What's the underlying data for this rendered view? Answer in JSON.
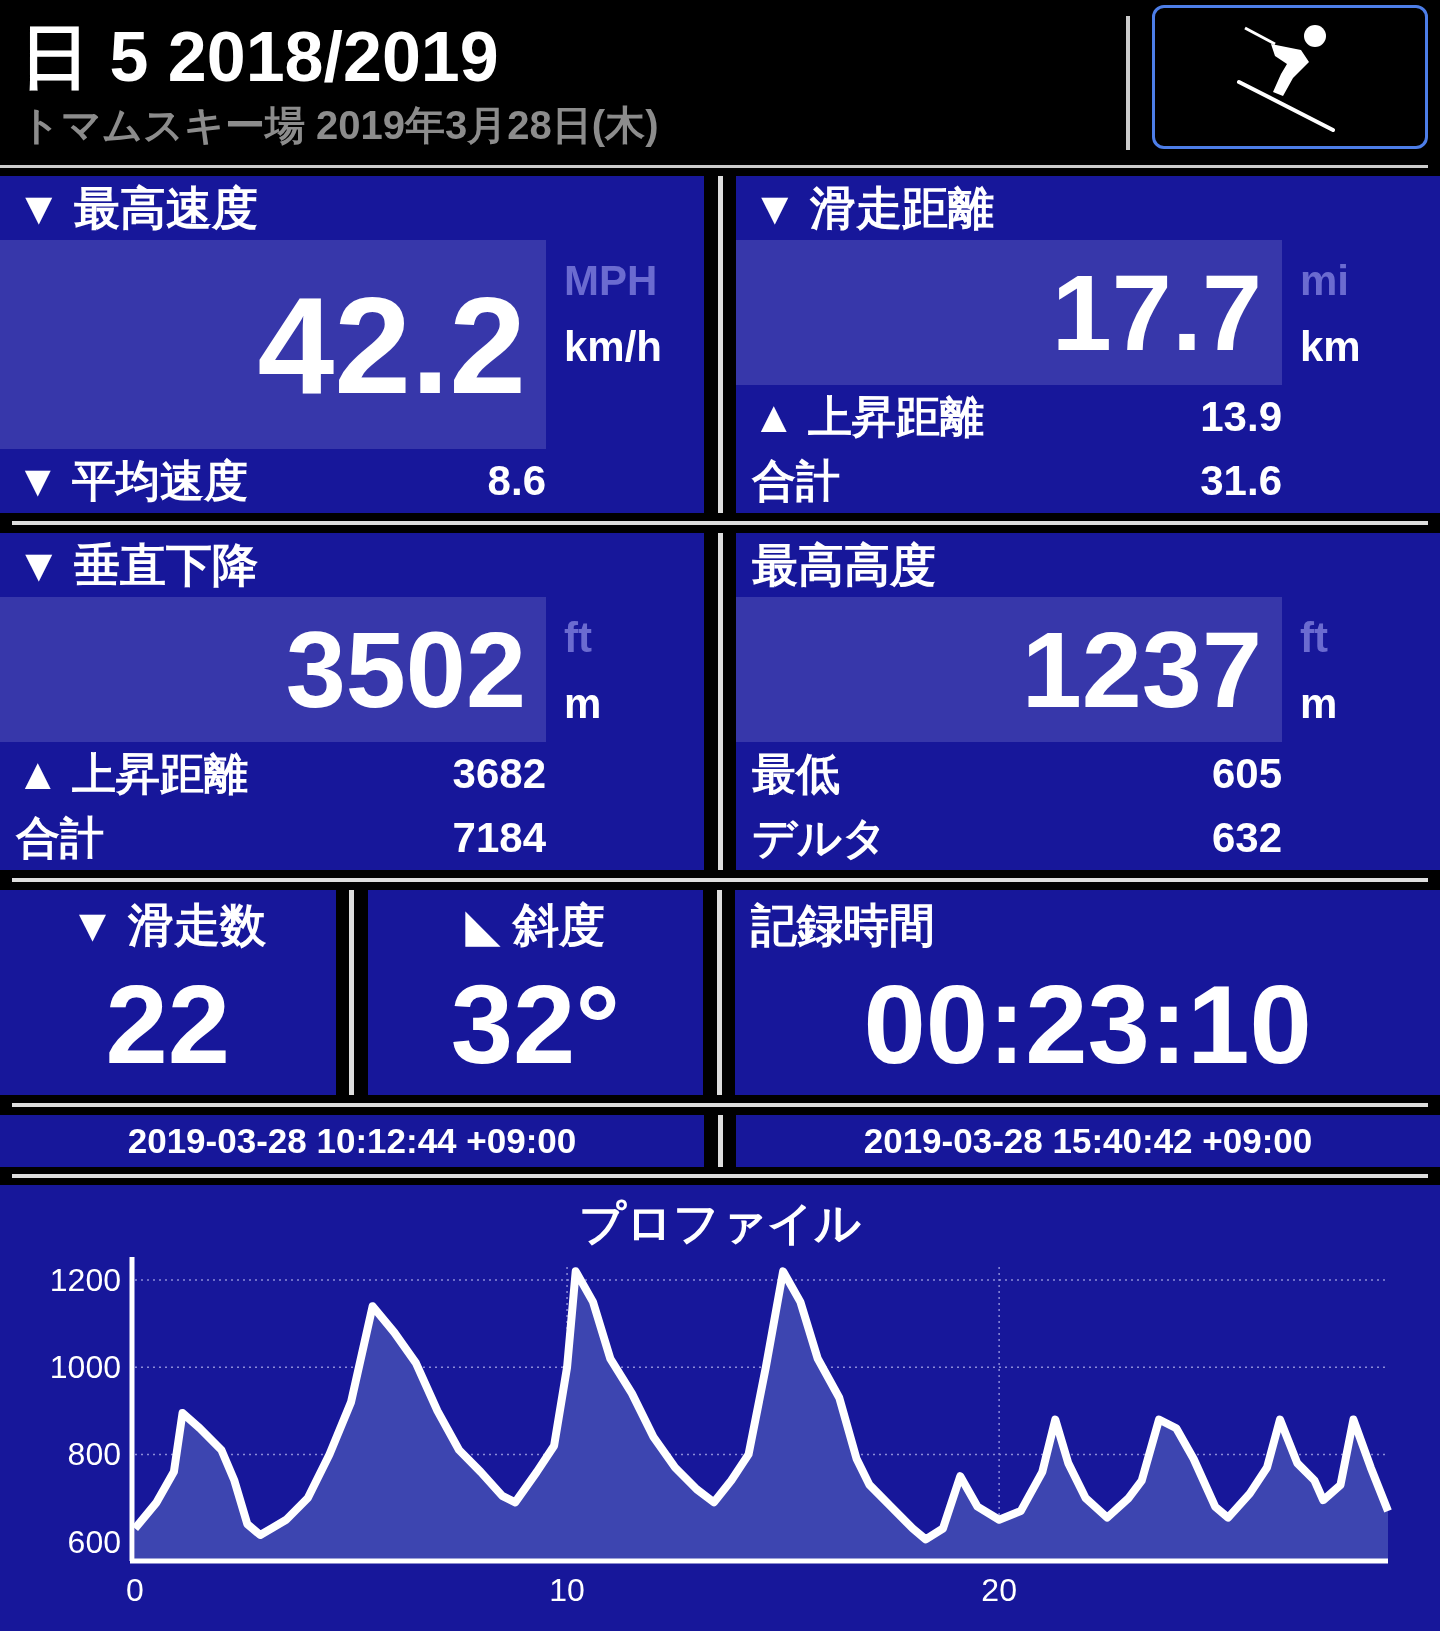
{
  "header": {
    "title": "日 5 2018/2019",
    "subtitle": "トマムスキー場 2019年3月28日(木)"
  },
  "panels": [
    {
      "title": "▼ 最高速度",
      "value": "42.2",
      "units": [
        {
          "label": "MPH",
          "selected": false
        },
        {
          "label": "km/h",
          "selected": true
        }
      ],
      "rows": [
        {
          "label": "▼ 平均速度",
          "value": "8.6"
        }
      ]
    },
    {
      "title": "▼ 滑走距離",
      "value": "17.7",
      "units": [
        {
          "label": "mi",
          "selected": false
        },
        {
          "label": "km",
          "selected": true
        }
      ],
      "rows": [
        {
          "label": "▲ 上昇距離",
          "value": "13.9"
        },
        {
          "label": "合計",
          "value": "31.6"
        }
      ]
    },
    {
      "title": "▼ 垂直下降",
      "value": "3502",
      "units": [
        {
          "label": "ft",
          "selected": false
        },
        {
          "label": "m",
          "selected": true
        }
      ],
      "rows": [
        {
          "label": "▲ 上昇距離",
          "value": "3682"
        },
        {
          "label": "合計",
          "value": "7184"
        }
      ]
    },
    {
      "title": "最高高度",
      "value": "1237",
      "units": [
        {
          "label": "ft",
          "selected": false
        },
        {
          "label": "m",
          "selected": true
        }
      ],
      "rows": [
        {
          "label": "最低",
          "value": "605"
        },
        {
          "label": "デルタ",
          "value": "632"
        }
      ]
    }
  ],
  "tiles": [
    {
      "title": "▼ 滑走数",
      "value": "22",
      "kind": "count"
    },
    {
      "title": "◣ 斜度",
      "value": "32°",
      "kind": "count"
    },
    {
      "title": "記録時間",
      "value": "00:23:10",
      "kind": "duration"
    }
  ],
  "timestamps": [
    "2019-03-28 10:12:44 +09:00",
    "2019-03-28 15:40:42 +09:00"
  ],
  "profile": {
    "title": "プロファイル",
    "chart_data": {
      "type": "area",
      "grid": true,
      "xlim": [
        0,
        29
      ],
      "ylim": [
        560,
        1230
      ],
      "xticks": [
        0,
        10,
        20
      ],
      "yticks": [
        600,
        800,
        1000,
        1200
      ],
      "x": [
        0,
        0.5,
        0.9,
        1.1,
        1.5,
        2,
        2.3,
        2.6,
        2.9,
        3.5,
        4,
        4.5,
        5,
        5.5,
        6,
        6.5,
        7,
        7.5,
        8,
        8.5,
        8.8,
        9.3,
        9.7,
        10,
        10.2,
        10.6,
        11,
        11.5,
        12,
        12.5,
        13,
        13.4,
        13.8,
        14.2,
        14.6,
        15,
        15.4,
        15.8,
        16.3,
        16.7,
        17,
        17.5,
        18,
        18.3,
        18.7,
        19.1,
        19.5,
        20,
        20.5,
        21,
        21.3,
        21.6,
        22,
        22.5,
        23,
        23.3,
        23.7,
        24.1,
        24.5,
        25,
        25.3,
        25.8,
        26.2,
        26.5,
        26.9,
        27.3,
        27.5,
        27.9,
        28.2,
        28.6,
        29
      ],
      "series": [
        {
          "color": "#ffffff",
          "values": [
            630,
            690,
            760,
            895,
            860,
            810,
            740,
            640,
            615,
            650,
            700,
            800,
            920,
            1140,
            1080,
            1010,
            900,
            810,
            760,
            705,
            690,
            760,
            820,
            1000,
            1220,
            1150,
            1020,
            940,
            840,
            770,
            720,
            690,
            740,
            800,
            1000,
            1220,
            1150,
            1020,
            930,
            790,
            730,
            680,
            630,
            605,
            630,
            750,
            680,
            650,
            670,
            760,
            880,
            780,
            700,
            655,
            700,
            740,
            880,
            860,
            790,
            680,
            655,
            710,
            770,
            880,
            780,
            740,
            695,
            730,
            880,
            770,
            670
          ]
        }
      ]
    }
  }
}
